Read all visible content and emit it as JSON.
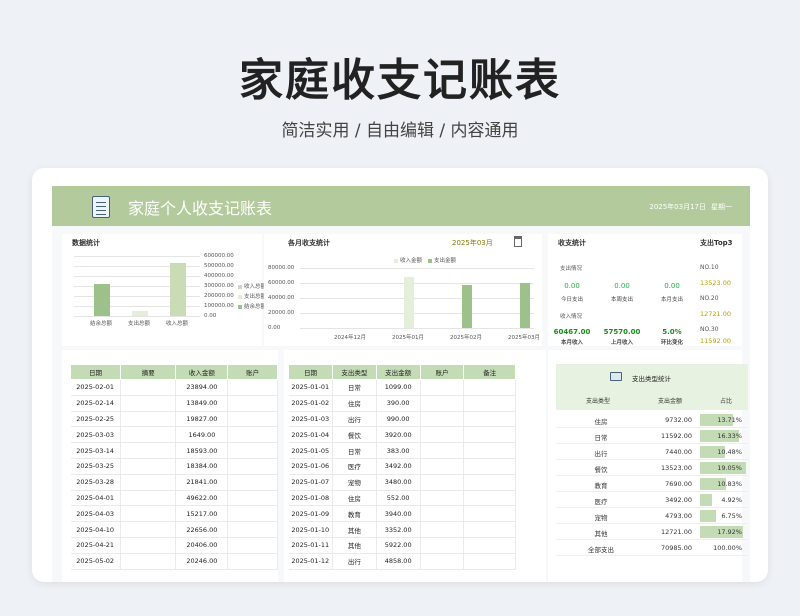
{
  "hero": {
    "title": "家庭收支记账表",
    "subtitle": "简洁实用 / 自由编辑 / 内容通用"
  },
  "banner": {
    "title": "家庭个人收支记账表",
    "date": "2025年03月17日",
    "weekday": "星期一",
    "icon": "notepad-icon"
  },
  "stats_panel": {
    "title": "数据统计",
    "chart_data": {
      "type": "bar",
      "categories": [
        "结余总额",
        "支出总额",
        "收入总额"
      ],
      "values": [
        320000,
        52000,
        530000
      ],
      "ylim": [
        0,
        600000
      ],
      "yticks": [
        "600000.00",
        "500000.00",
        "400000.00",
        "300000.00",
        "200000.00",
        "100000.00",
        "0.00"
      ],
      "legend": [
        "收入总额",
        "支出总额",
        "结余总额"
      ],
      "colors": [
        "#c9dcb6",
        "#e3efd8",
        "#9cc18a"
      ]
    }
  },
  "monthly_panel": {
    "title": "各月收支统计",
    "month": "2025年03月",
    "chart_data": {
      "type": "bar",
      "categories": [
        "2024年12月",
        "2025年01月",
        "2025年02月",
        "2025年03月"
      ],
      "series": [
        {
          "name": "收入金额",
          "values": [
            0,
            68000,
            57500,
            60500
          ],
          "color": "#e3efd8"
        },
        {
          "name": "支出金额",
          "values": [
            0,
            0,
            0,
            0
          ],
          "color": "#9cc18a"
        }
      ],
      "ylim": [
        0,
        80000
      ],
      "yticks": [
        "80000.00",
        "60000.00",
        "40000.00",
        "20000.00",
        "0.00"
      ]
    }
  },
  "summary_panel": {
    "title": "收支统计",
    "expense_title": "支出情况",
    "expense": [
      {
        "value": "0.00",
        "label": "今日支出"
      },
      {
        "value": "0.00",
        "label": "本周支出"
      },
      {
        "value": "0.00",
        "label": "本月支出"
      }
    ],
    "income_title": "收入情况",
    "income": [
      {
        "value": "60467.00",
        "label": "本月收入"
      },
      {
        "value": "57570.00",
        "label": "上月收入"
      },
      {
        "value": "5.0%",
        "label": "环比变化"
      }
    ],
    "top3_title": "支出Top3",
    "top3": [
      {
        "rank": "NO.10",
        "value": "13523.00"
      },
      {
        "rank": "NO.20",
        "value": "12721.00"
      },
      {
        "rank": "NO.30",
        "value": "11592.00"
      }
    ],
    "colors": {
      "zero": "#2aa84a",
      "income": "#1a8c1a",
      "top": "#b8a000"
    }
  },
  "income_table": {
    "headers": [
      "日期",
      "摘要",
      "收入金额",
      "账户"
    ],
    "rows": [
      [
        "2025-02-01",
        "",
        "23894.00",
        ""
      ],
      [
        "2025-02-14",
        "",
        "13849.00",
        ""
      ],
      [
        "2025-02-25",
        "",
        "19827.00",
        ""
      ],
      [
        "2025-03-03",
        "",
        "1649.00",
        ""
      ],
      [
        "2025-03-14",
        "",
        "18593.00",
        ""
      ],
      [
        "2025-03-25",
        "",
        "18384.00",
        ""
      ],
      [
        "2025-03-28",
        "",
        "21841.00",
        ""
      ],
      [
        "2025-04-01",
        "",
        "49622.00",
        ""
      ],
      [
        "2025-04-03",
        "",
        "15217.00",
        ""
      ],
      [
        "2025-04-10",
        "",
        "22656.00",
        ""
      ],
      [
        "2025-04-21",
        "",
        "20406.00",
        ""
      ],
      [
        "2025-05-02",
        "",
        "20246.00",
        ""
      ]
    ]
  },
  "expense_table": {
    "headers": [
      "日期",
      "支出类型",
      "支出金额",
      "账户",
      "备注"
    ],
    "rows": [
      [
        "2025-01-01",
        "日常",
        "1099.00",
        "",
        ""
      ],
      [
        "2025-01-02",
        "住房",
        "390.00",
        "",
        ""
      ],
      [
        "2025-01-03",
        "出行",
        "990.00",
        "",
        ""
      ],
      [
        "2025-01-04",
        "餐饮",
        "3920.00",
        "",
        ""
      ],
      [
        "2025-01-05",
        "日常",
        "383.00",
        "",
        ""
      ],
      [
        "2025-01-06",
        "医疗",
        "3492.00",
        "",
        ""
      ],
      [
        "2025-01-07",
        "宠物",
        "3480.00",
        "",
        ""
      ],
      [
        "2025-01-08",
        "住房",
        "552.00",
        "",
        ""
      ],
      [
        "2025-01-09",
        "教育",
        "3940.00",
        "",
        ""
      ],
      [
        "2025-01-10",
        "其他",
        "3352.00",
        "",
        ""
      ],
      [
        "2025-01-11",
        "其他",
        "5922.00",
        "",
        ""
      ],
      [
        "2025-01-12",
        "出行",
        "4858.00",
        "",
        ""
      ]
    ]
  },
  "type_stats": {
    "title": "支出类型统计",
    "icon": "monitor-icon",
    "headers": [
      "支出类型",
      "支出金额",
      "占比"
    ],
    "rows": [
      {
        "type": "住房",
        "amount": "9732.00",
        "pct": "13.71%",
        "ratio": 0.1371
      },
      {
        "type": "日常",
        "amount": "11592.00",
        "pct": "16.33%",
        "ratio": 0.1633
      },
      {
        "type": "出行",
        "amount": "7440.00",
        "pct": "10.48%",
        "ratio": 0.1048
      },
      {
        "type": "餐饮",
        "amount": "13523.00",
        "pct": "19.05%",
        "ratio": 0.1905
      },
      {
        "type": "教育",
        "amount": "7690.00",
        "pct": "10.83%",
        "ratio": 0.1083
      },
      {
        "type": "医疗",
        "amount": "3492.00",
        "pct": "4.92%",
        "ratio": 0.0492
      },
      {
        "type": "宠物",
        "amount": "4793.00",
        "pct": "6.75%",
        "ratio": 0.0675
      },
      {
        "type": "其他",
        "amount": "12721.00",
        "pct": "17.92%",
        "ratio": 0.1792
      }
    ],
    "total": {
      "type": "全部支出",
      "amount": "70985.00",
      "pct": "100.00%"
    }
  }
}
